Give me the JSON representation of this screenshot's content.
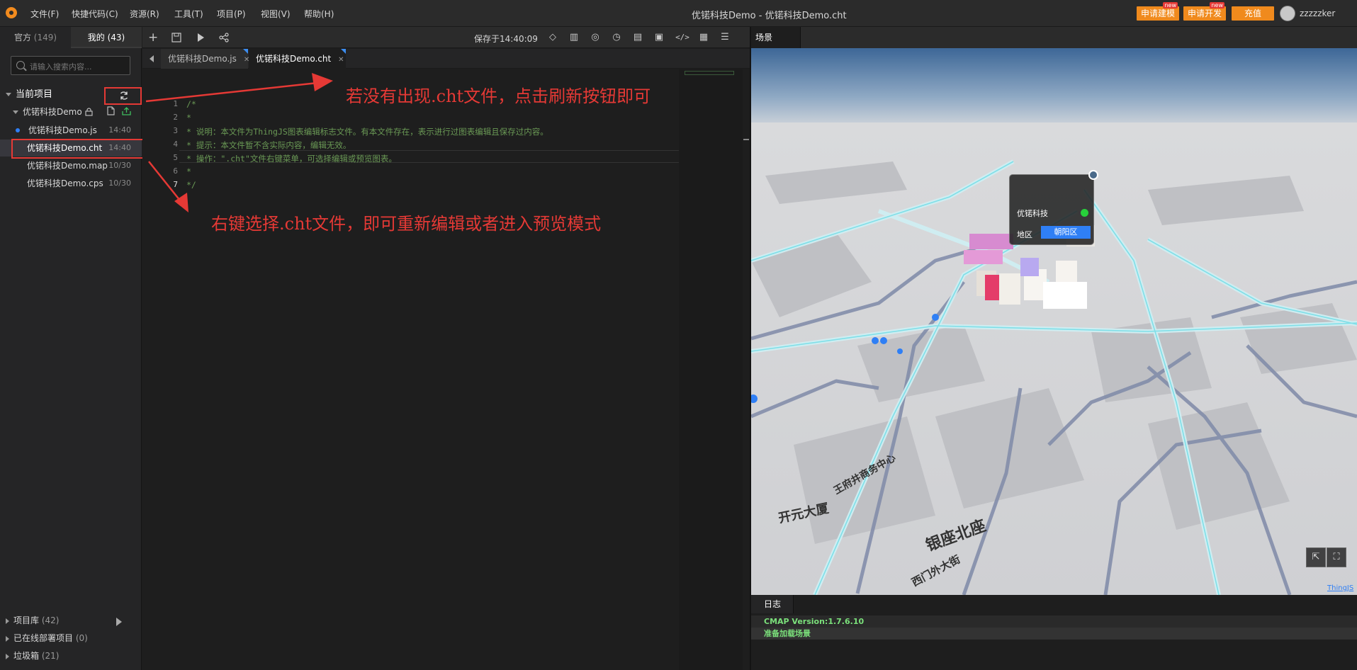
{
  "menubar": {
    "items": [
      "文件(F)",
      "快捷代码(C)",
      "资源(R)",
      "工具(T)",
      "项目(P)",
      "视图(V)",
      "帮助(H)"
    ],
    "window_title": "优锘科技Demo - 优锘科技Demo.cht",
    "buttons": [
      {
        "label": "申请建模",
        "badge": "new"
      },
      {
        "label": "申请开发",
        "badge": "new"
      },
      {
        "label": "充值"
      }
    ],
    "username": "zzzzzker"
  },
  "left_panel": {
    "tabs": [
      {
        "label": "官方",
        "count": "(149)"
      },
      {
        "label": "我的",
        "count": "(43)"
      }
    ],
    "search_placeholder": "请输入搜索内容...",
    "current_project_label": "当前项目",
    "project_name": "优锘科技Demo",
    "files": [
      {
        "name": "优锘科技Demo.js",
        "time": "14:40"
      },
      {
        "name": "优锘科技Demo.cht",
        "time": "14:40"
      },
      {
        "name": "优锘科技Demo.map",
        "time": "10/30"
      },
      {
        "name": "优锘科技Demo.cps",
        "time": "10/30"
      }
    ],
    "bottom": [
      {
        "label": "项目库",
        "count": "(42)"
      },
      {
        "label": "已在线部署项目",
        "count": "(0)"
      },
      {
        "label": "垃圾箱",
        "count": "(21)"
      }
    ]
  },
  "editor": {
    "saved_text": "保存于14:40:09",
    "tabs": [
      "优锘科技Demo.js",
      "优锘科技Demo.cht"
    ],
    "lines": [
      "/*",
      "*",
      "* 说明：本文件为ThingJS图表编辑标志文件。有本文件存在，表示进行过图表编辑且保存过内容。",
      "* 提示：本文件暂不含实际内容，编辑无效。",
      "* 操作：\".cht\"文件右键菜单，可选择编辑或预览图表。",
      "*",
      "*/"
    ],
    "line_numbers": [
      "1",
      "2",
      "3",
      "4",
      "5",
      "6",
      "7"
    ],
    "current_line": 7
  },
  "scene": {
    "tab_label": "场景",
    "popup": {
      "name": "优锘科技",
      "region_label": "地区",
      "region_value": "朝阳区",
      "status_color": "#27d13b"
    },
    "map_labels": [
      "开元大厦",
      "王府井商务中心",
      "西门外大街",
      "银座北座"
    ],
    "credit": "ThingJS"
  },
  "log": {
    "tab_label": "日志",
    "lines": [
      "CMAP Version:1.7.6.10",
      "准备加载场景"
    ]
  },
  "annotations": {
    "refresh_hint": "若没有出现.cht文件，点击刷新按钮即可",
    "rightclick_hint": "右键选择.cht文件，即可重新编辑或者进入预览模式"
  },
  "colors": {
    "accent_orange": "#f08a1d",
    "annotation_red": "#e53935",
    "link_blue": "#2f7ff5"
  }
}
